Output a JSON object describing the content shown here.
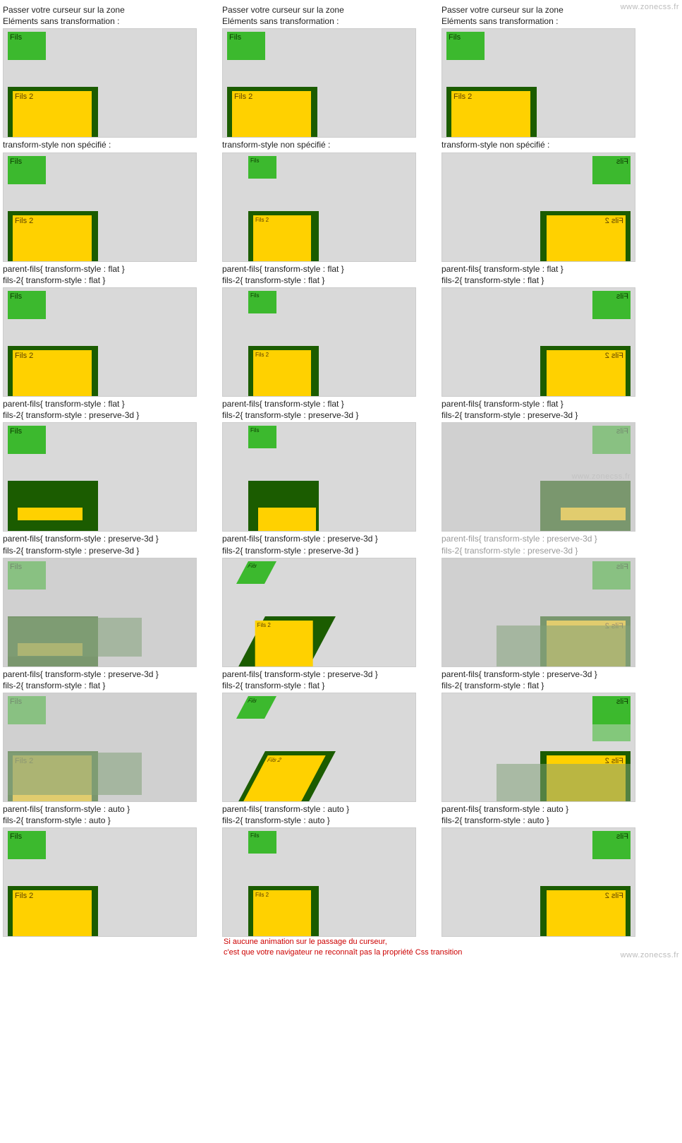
{
  "watermarks": [
    "www.zonecss.fr",
    "www.zonecss.fr",
    "www.zonecss.fr"
  ],
  "hoverHint": "Passer votre curseur sur la zone",
  "labels": {
    "fils": "Fils",
    "fils2": "Fils 2"
  },
  "rows": [
    {
      "h": "Eléments sans transformation :",
      "variant": "plain"
    },
    {
      "h": "transform-style non spécifié :",
      "variant": "ts"
    },
    {
      "h": "parent-fils{ transform-style : flat }\nfils-2{ transform-style : flat }",
      "variant": "ts"
    },
    {
      "h": "parent-fils{ transform-style : flat }\nfils-2{ transform-style : preserve-3d }",
      "variant": "bar"
    },
    {
      "h": "parent-fils{ transform-style : preserve-3d }\nfils-2{ transform-style : preserve-3d }",
      "variant": "p3d"
    },
    {
      "h": "parent-fils{ transform-style : preserve-3d }\nfils-2{ transform-style : flat }",
      "variant": "p3df"
    },
    {
      "h": "parent-fils{ transform-style : auto }\nfils-2{ transform-style : auto }",
      "variant": "ts"
    }
  ],
  "warning": "Si aucune animation sur le passage du curseur,\nc'est que votre navigateur ne reconnaît pas la propriété Css transition"
}
